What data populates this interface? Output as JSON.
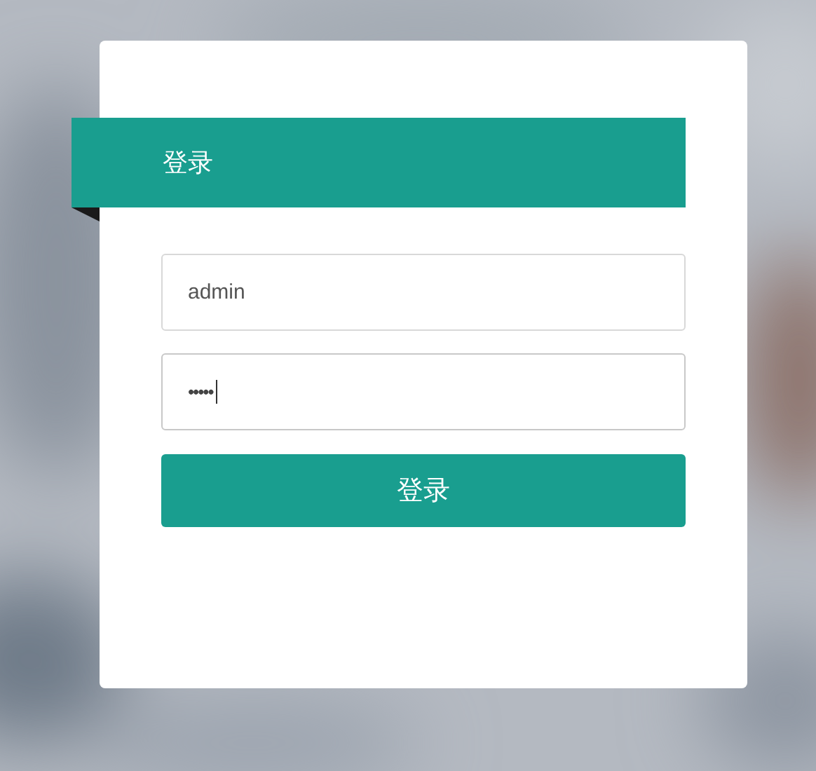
{
  "header": {
    "title": "登录"
  },
  "username": {
    "value": "admin"
  },
  "password": {
    "value": "•••••"
  },
  "submit": {
    "label": "登录"
  }
}
